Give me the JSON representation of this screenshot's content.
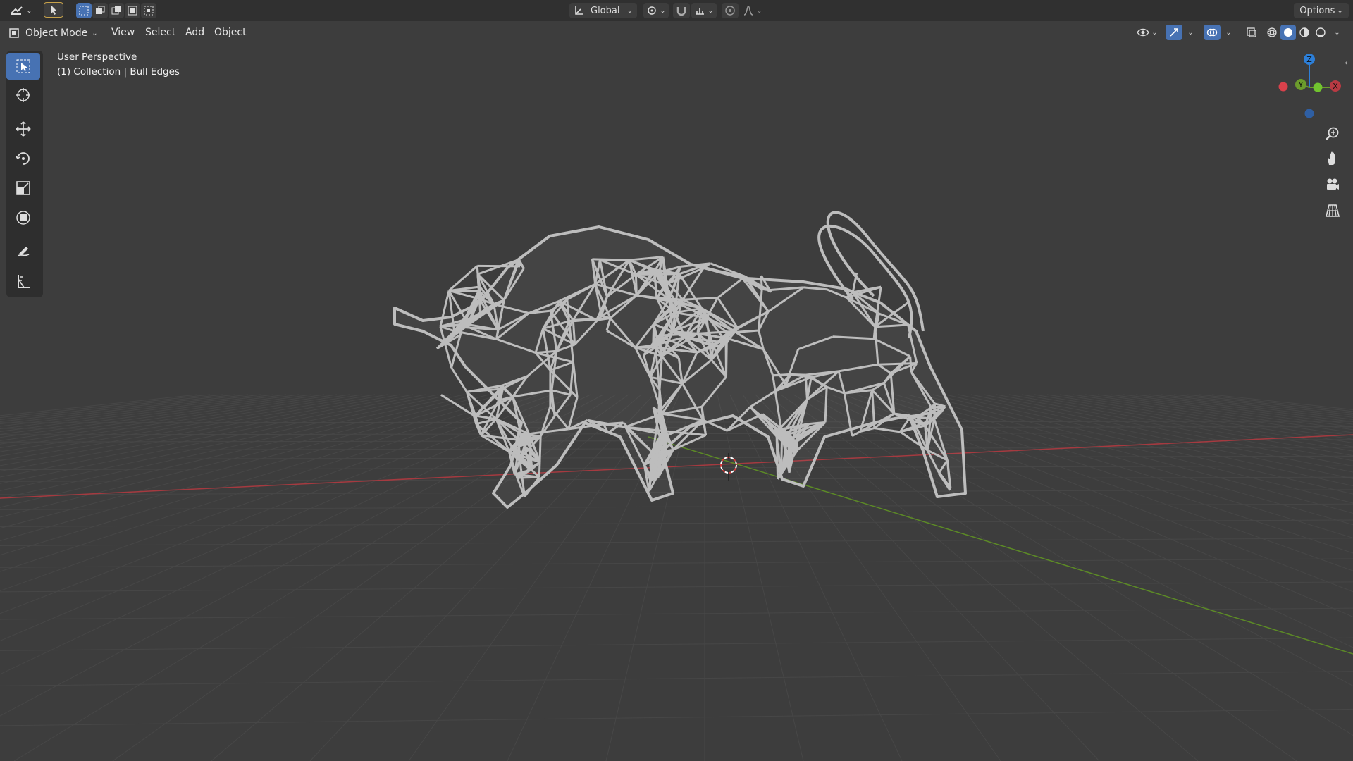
{
  "topbar": {
    "transform_orientation": "Global",
    "options_label": "Options"
  },
  "header": {
    "mode": "Object Mode",
    "menus": [
      "View",
      "Select",
      "Add",
      "Object"
    ]
  },
  "viewport": {
    "perspective_label": "User Perspective",
    "collection_label": "(1) Collection | Bull Edges",
    "axis_labels": {
      "z": "Z",
      "y": "Y",
      "x": "X"
    }
  },
  "colors": {
    "accent": "#4772b3",
    "grid_background": "#3d3d3d",
    "x_axis": "#c8414b",
    "y_axis": "#6c9c2c",
    "z_axis": "#2d7fd8"
  },
  "icons": {
    "toolbar": [
      "select-box-icon",
      "cursor-icon",
      "move-icon",
      "rotate-icon",
      "scale-icon",
      "transform-icon",
      "annotate-icon",
      "measure-icon"
    ],
    "navigation": [
      "zoom-icon",
      "hand-pan-icon",
      "camera-icon",
      "grid-ortho-icon"
    ]
  }
}
